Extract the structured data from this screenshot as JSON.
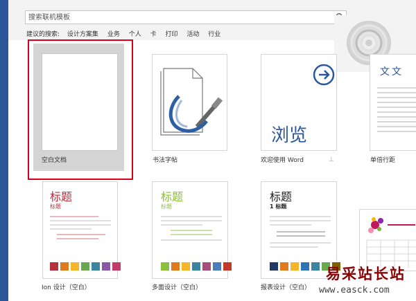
{
  "search": {
    "placeholder": "搜索联机模板",
    "icon": "search-icon"
  },
  "suggested": {
    "label": "建议的搜索:",
    "items": [
      "设计方案集",
      "业务",
      "个人",
      "卡",
      "打印",
      "活动",
      "行业"
    ]
  },
  "templates": [
    {
      "label": "空白文档",
      "selected": true
    },
    {
      "label": "书法字帖"
    },
    {
      "label": "欢迎使用 Word",
      "preview_text": "浏览"
    },
    {
      "label": "单倍行距",
      "preview_text": "文文"
    },
    {
      "label": "Ion 设计（空白）",
      "heading": "标题",
      "subheading": "标题"
    },
    {
      "label": "多面设计（空白）",
      "heading": "标题",
      "subheading": "标题"
    },
    {
      "label": "报表设计（空白）",
      "heading": "标题",
      "subheading": "1  标题"
    }
  ],
  "colors": {
    "accent": "#2b579a",
    "selection": "#d9001b",
    "ion_red": "#b5303a",
    "facet_green": "#8cbf3f"
  },
  "watermark": {
    "cn": "易采站长站",
    "url": "www.easck.com"
  }
}
